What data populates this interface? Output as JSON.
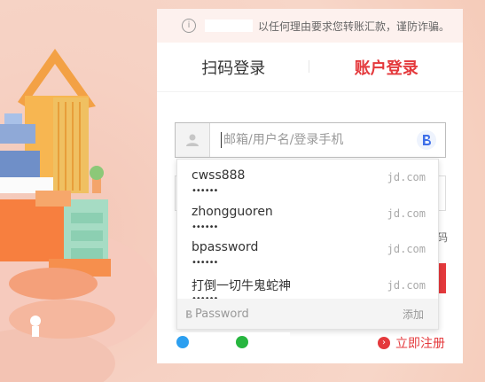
{
  "notice": {
    "text": "以任何理由要求您转账汇款，谨防诈骗。",
    "icon": "i"
  },
  "tabs": {
    "qr_label": "扫码登录",
    "account_label": "账户登录"
  },
  "username_field": {
    "placeholder": "邮箱/用户名/登录手机"
  },
  "dropdown": {
    "items": [
      {
        "username": "cwss888",
        "password_mask": "••••••",
        "domain": "jd.com"
      },
      {
        "username": "zhongguoren",
        "password_mask": "••••••",
        "domain": "jd.com"
      },
      {
        "username": "bpassword",
        "password_mask": "••••••",
        "domain": "jd.com"
      },
      {
        "username": "打倒一切牛鬼蛇神",
        "password_mask": "••••••",
        "domain": "jd.com"
      }
    ],
    "footer": {
      "label": "Password",
      "add_label": "添加"
    }
  },
  "background_text": {
    "fragment": "码"
  },
  "register": {
    "label": "立即注册",
    "icon": "›"
  },
  "colors": {
    "accent": "#e4393c",
    "qq": "#2c9ff0",
    "wechat": "#27b63f"
  }
}
